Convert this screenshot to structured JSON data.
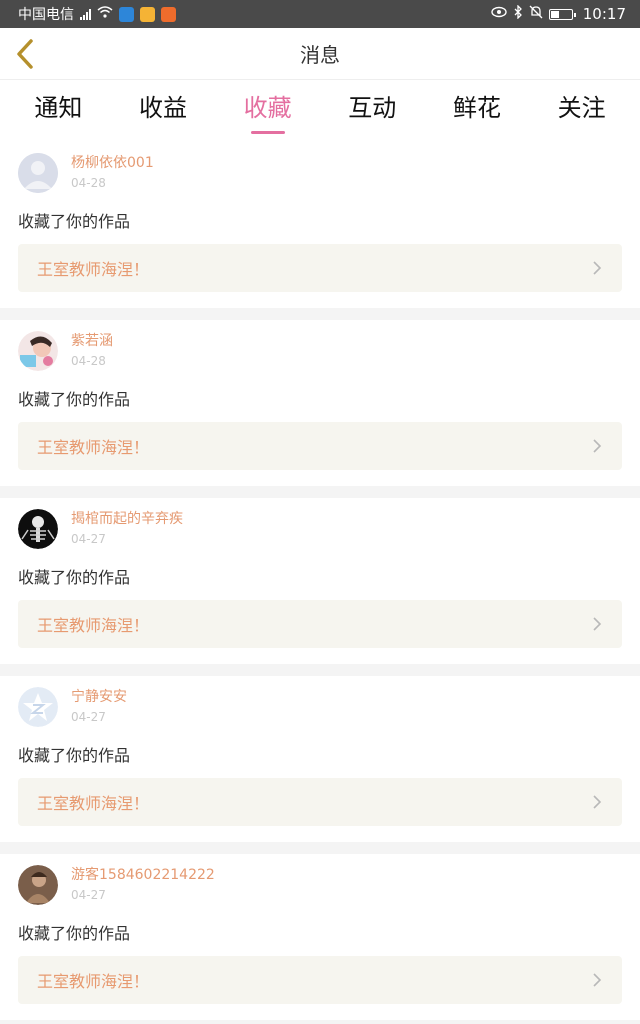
{
  "status_bar": {
    "carrier": "中国电信",
    "network": "3G",
    "time": "10:17",
    "icons": [
      "signal-icon",
      "wifi-icon",
      "shield-app-icon",
      "app-icon-orange",
      "app-icon-red",
      "eye-icon",
      "bluetooth-icon",
      "mute-icon",
      "battery-icon"
    ]
  },
  "nav": {
    "title": "消息",
    "back_icon": "chevron-left-icon"
  },
  "tabs": [
    {
      "label": "通知",
      "active": false
    },
    {
      "label": "收益",
      "active": false
    },
    {
      "label": "收藏",
      "active": true
    },
    {
      "label": "互动",
      "active": false
    },
    {
      "label": "鲜花",
      "active": false
    },
    {
      "label": "关注",
      "active": false
    }
  ],
  "colors": {
    "accent": "#e46fa0",
    "name": "#e59a72",
    "work_bg": "#f6f5ef",
    "status_bar": "#4a4a4a"
  },
  "messages": [
    {
      "user": "杨柳依依001",
      "date": "04-28",
      "action": "收藏了你的作品",
      "work": "王室教师海涅！",
      "avatar": "default-avatar"
    },
    {
      "user": "紫若涵",
      "date": "04-28",
      "action": "收藏了你的作品",
      "work": "王室教师海涅！",
      "avatar": "child-photo-avatar"
    },
    {
      "user": "揭棺而起的辛弃疾",
      "date": "04-27",
      "action": "收藏了你的作品",
      "work": "王室教师海涅！",
      "avatar": "skeleton-avatar"
    },
    {
      "user": "宁静安安",
      "date": "04-27",
      "action": "收藏了你的作品",
      "work": "王室教师海涅！",
      "avatar": "qzone-star-avatar"
    },
    {
      "user": "游客1584602214222",
      "date": "04-27",
      "action": "收藏了你的作品",
      "work": "王室教师海涅！",
      "avatar": "photo-avatar"
    }
  ]
}
